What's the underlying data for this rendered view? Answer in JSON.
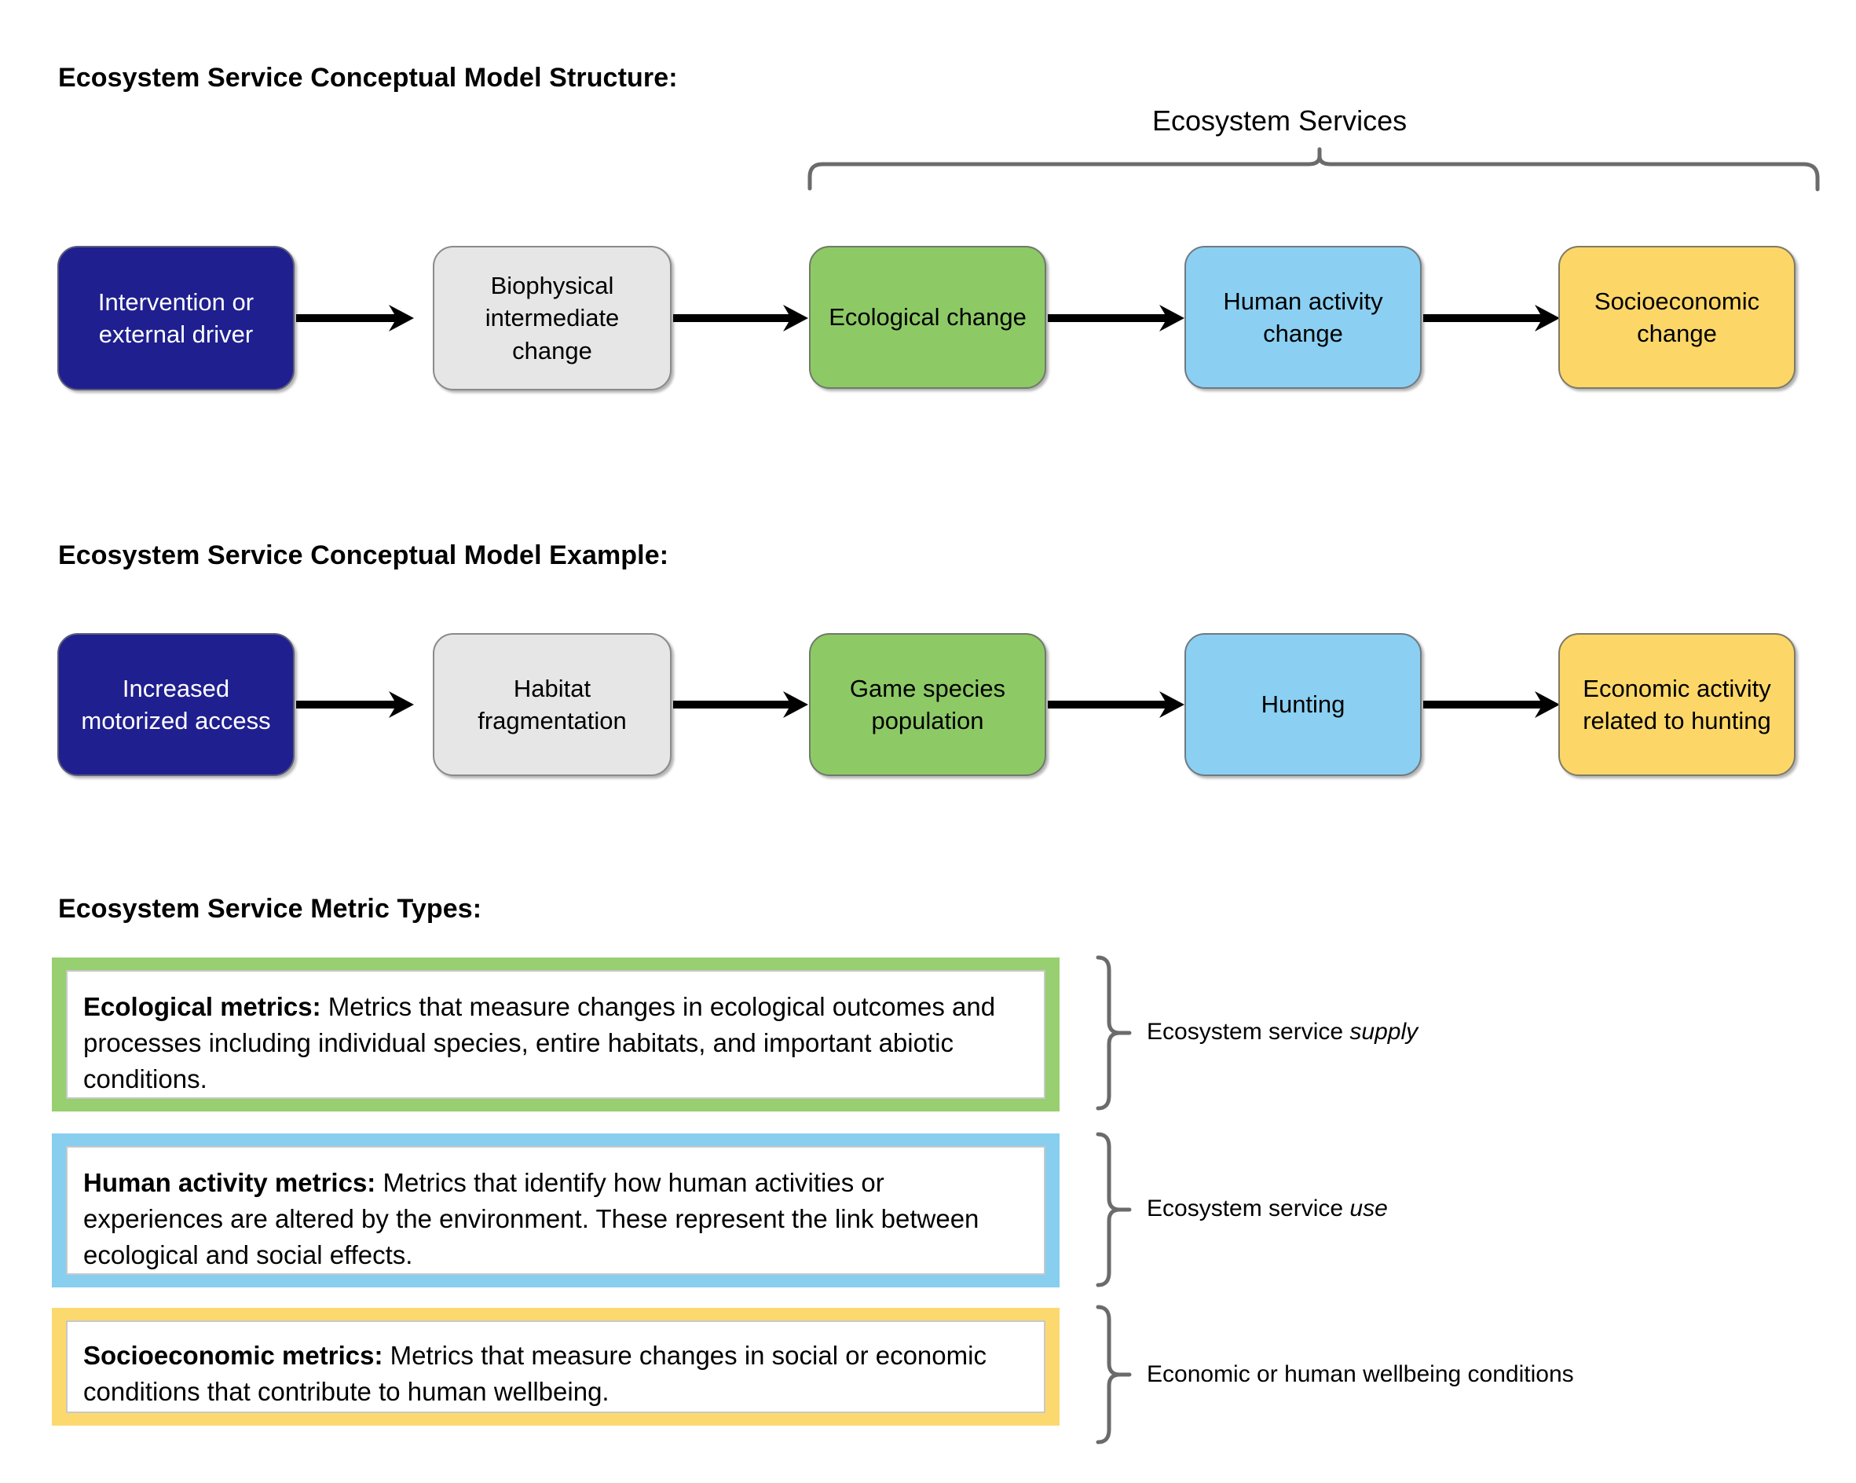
{
  "sections": {
    "structure_title": "Ecosystem Service Conceptual Model Structure:",
    "example_title": "Ecosystem Service Conceptual Model Example:",
    "metrics_title": "Ecosystem Service Metric Types:"
  },
  "ecosystem_services_bracket_label": "Ecosystem Services",
  "structure_flow": [
    {
      "label": "Intervention or external driver",
      "color": "#1f1f8f",
      "text_color": "#ffffff"
    },
    {
      "label": "Biophysical intermediate change",
      "color": "#e6e6e6",
      "text_color": "#000000"
    },
    {
      "label": "Ecological change",
      "color": "#8dca66",
      "text_color": "#000000"
    },
    {
      "label": "Human activity change",
      "color": "#8bd0f2",
      "text_color": "#000000"
    },
    {
      "label": "Socioeconomic change",
      "color": "#fcd768",
      "text_color": "#000000"
    }
  ],
  "example_flow": [
    {
      "label": "Increased motorized access",
      "color": "#1f1f8f",
      "text_color": "#ffffff"
    },
    {
      "label": "Habitat fragmentation",
      "color": "#e6e6e6",
      "text_color": "#000000"
    },
    {
      "label": "Game species population",
      "color": "#8dca66",
      "text_color": "#000000"
    },
    {
      "label": "Hunting",
      "color": "#8bd0f2",
      "text_color": "#000000"
    },
    {
      "label": "Economic activity related to hunting",
      "color": "#fcd768",
      "text_color": "#000000"
    }
  ],
  "metric_types": [
    {
      "term": "Ecological metrics:",
      "description": " Metrics that measure changes in ecological outcomes and processes including individual species, entire habitats, and important abiotic conditions.",
      "border_color": "#97cf71",
      "bracket_label_plain": "Ecosystem service ",
      "bracket_label_italic": "supply"
    },
    {
      "term": "Human activity metrics:",
      "description": " Metrics that identify how human activities or experiences are altered by the environment. These represent the link between ecological and social effects.",
      "border_color": "#87ceef",
      "bracket_label_plain": "Ecosystem service ",
      "bracket_label_italic": "use"
    },
    {
      "term": "Socioeconomic metrics:",
      "description": " Metrics that measure changes in social or economic conditions that contribute to human wellbeing.",
      "border_color": "#fcd96f",
      "bracket_label_plain": "Economic or human wellbeing conditions",
      "bracket_label_italic": ""
    }
  ]
}
